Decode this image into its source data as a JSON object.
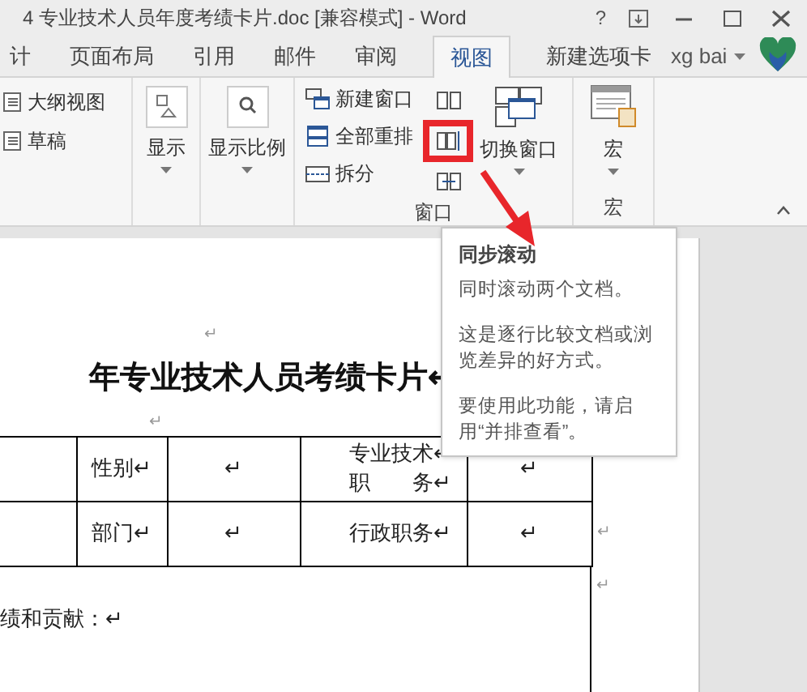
{
  "window": {
    "title": "4 专业技术人员年度考绩卡片.doc [兼容模式] - Word",
    "help": "?"
  },
  "tabs": [
    {
      "label": "计",
      "selected": false
    },
    {
      "label": "页面布局",
      "selected": false
    },
    {
      "label": "引用",
      "selected": false
    },
    {
      "label": "邮件",
      "selected": false
    },
    {
      "label": "审阅",
      "selected": false
    },
    {
      "label": "视图",
      "selected": true
    },
    {
      "label": "新建选项卡",
      "selected": false
    }
  ],
  "account": {
    "name": "xg bai"
  },
  "ribbon": {
    "views": [
      "大纲视图",
      "草稿"
    ],
    "show": {
      "label": "显示"
    },
    "zoom": {
      "label": "显示比例"
    },
    "window": {
      "commands": [
        "新建窗口",
        "全部重排",
        "拆分"
      ],
      "compare_buttons": [
        {
          "annotated": false
        },
        {
          "annotated": true
        },
        {
          "annotated": false
        }
      ],
      "switch": {
        "label": "切换窗口"
      },
      "label": "窗口"
    },
    "macros": {
      "button": "宏",
      "label": "宏"
    }
  },
  "tooltip": {
    "title": "同步滚动",
    "paragraphs": [
      "同时滚动两个文档。",
      "这是逐行比较文档或浏览差异的好方式。",
      "要使用此功能，请启用“并排查看”。"
    ]
  },
  "document": {
    "lead_mark": "↵",
    "title": "年专业技术人员考绩卡片↵",
    "mark_after_title": "↵",
    "table": {
      "rows": [
        {
          "cells": [
            [],
            [
              "性别↵"
            ],
            [
              "↵"
            ],
            [
              "专业技术↵",
              "职　　务↵"
            ],
            [
              "↵"
            ]
          ]
        },
        {
          "cells": [
            [],
            [
              "部门↵"
            ],
            [
              "↵"
            ],
            [
              "行政职务↵"
            ],
            [
              "↵"
            ]
          ],
          "end_mark": "↵"
        }
      ]
    },
    "after_table_mark": "↵",
    "section": "绩和贡献：↵"
  }
}
